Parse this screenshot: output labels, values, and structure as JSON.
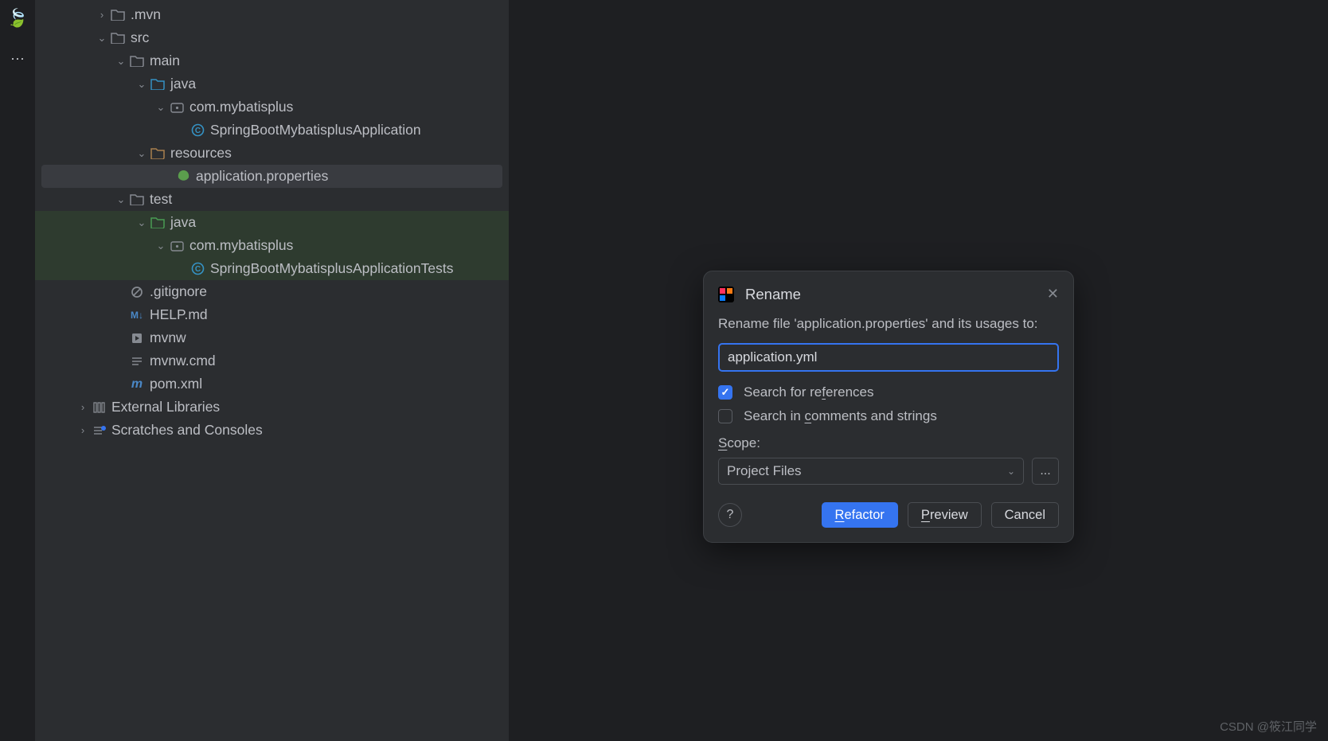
{
  "gutter": {
    "brand_glyph": "🍃"
  },
  "tree": {
    "mvn": ".mvn",
    "src": "src",
    "main": "main",
    "java": "java",
    "pkg": "com.mybatisplus",
    "app_class": "SpringBootMybatisplusApplication",
    "resources": "resources",
    "app_props": "application.properties",
    "test": "test",
    "java2": "java",
    "pkg2": "com.mybatisplus",
    "test_class": "SpringBootMybatisplusApplicationTests",
    "gitignore": ".gitignore",
    "help_md": "HELP.md",
    "mvnw": "mvnw",
    "mvnw_cmd": "mvnw.cmd",
    "pom": "pom.xml",
    "ext_libs": "External Libraries",
    "scratches": "Scratches and Consoles"
  },
  "dialog": {
    "title": "Rename",
    "prompt": "Rename file 'application.properties' and its usages to:",
    "input_value": "application.yml",
    "chk_refs": "Search for references",
    "chk_comments": "Search in comments and strings",
    "scope_label": "Scope:",
    "scope_value": "Project Files",
    "more": "...",
    "help": "?",
    "refactor": "Refactor",
    "preview": "Preview",
    "cancel": "Cancel"
  },
  "watermark": "CSDN @筱江同学",
  "mnemonics": {
    "refs_u": "f",
    "comments_u": "c",
    "scope_u": "S",
    "refactor_u": "R",
    "preview_u": "P"
  }
}
